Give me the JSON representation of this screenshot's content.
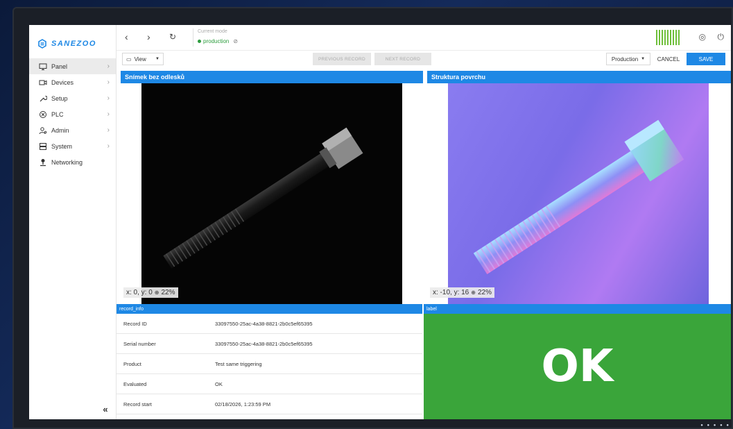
{
  "app": {
    "logo_text": "SANEZOO"
  },
  "sidebar": {
    "items": [
      {
        "label": "Panel",
        "icon": "monitor-icon",
        "chevron": true,
        "active": true
      },
      {
        "label": "Devices",
        "icon": "camera-icon",
        "chevron": true
      },
      {
        "label": "Setup",
        "icon": "wrench-icon",
        "chevron": true
      },
      {
        "label": "PLC",
        "icon": "plc-icon",
        "chevron": true
      },
      {
        "label": "Admin",
        "icon": "admin-icon",
        "chevron": true
      },
      {
        "label": "System",
        "icon": "server-icon",
        "chevron": true
      },
      {
        "label": "Networking",
        "icon": "network-icon",
        "chevron": false
      }
    ],
    "collapse_glyph": "«"
  },
  "topbar": {
    "back_glyph": "‹",
    "forward_glyph": "›",
    "refresh_glyph": "↻",
    "mode_label": "Current mode",
    "mode_value": "production",
    "user_glyph": "◎",
    "power_glyph": "⏻"
  },
  "toolbar": {
    "view_label": "View",
    "previous_label": "PREVIOUS RECORD",
    "next_label": "NEXT RECORD",
    "production_label": "Production",
    "cancel_label": "CANCEL",
    "save_label": "SAVE"
  },
  "panels": {
    "left_title": "Snímek bez odlesků",
    "left_coords": "x: 0, y: 0",
    "left_zoom": "22%",
    "right_title": "Struktura povrchu",
    "right_coords": "x: -10, y: 16",
    "right_zoom": "22%"
  },
  "record_info": {
    "title": "record_info",
    "rows": [
      {
        "key": "Record ID",
        "value": "33097550-25ac-4a38-8821-2b0c5ef65395"
      },
      {
        "key": "Serial number",
        "value": "33097550-25ac-4a38-8821-2b0c5ef65395"
      },
      {
        "key": "Product",
        "value": "Test same triggering"
      },
      {
        "key": "Evaluated",
        "value": "OK"
      },
      {
        "key": "Record start",
        "value": "02/18/2026, 1:23:59 PM"
      }
    ]
  },
  "label": {
    "title": "label",
    "value": "OK",
    "color": "#3aa53a"
  },
  "colors": {
    "accent": "#1e88e5",
    "ok_green": "#3aa53a",
    "mode_green": "#2e9d3f"
  }
}
